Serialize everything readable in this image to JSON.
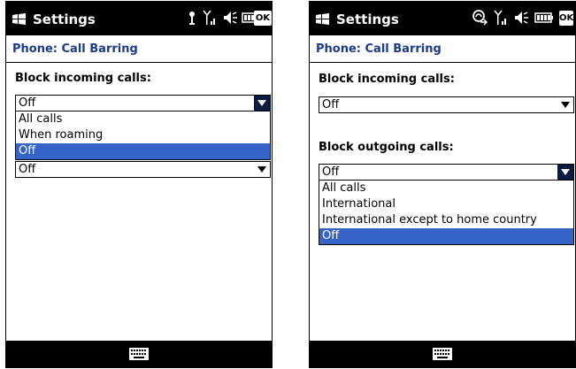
{
  "left": {
    "title": "Settings",
    "ok_label": "OK",
    "header": "Phone: Call Barring",
    "incoming_label": "Block incoming calls:",
    "incoming_value": "Off",
    "incoming_options": [
      "All calls",
      "When roaming",
      "Off"
    ],
    "incoming_selected_index": 2,
    "outgoing_value": "Off",
    "tray_icons": [
      "antenna-icon",
      "signal-icon",
      "speaker-icon",
      "battery-icon"
    ]
  },
  "right": {
    "title": "Settings",
    "ok_label": "OK",
    "header": "Phone: Call Barring",
    "incoming_label": "Block incoming calls:",
    "incoming_value": "Off",
    "outgoing_label": "Block outgoing calls:",
    "outgoing_value": "Off",
    "outgoing_options": [
      "All calls",
      "International",
      "International except to home country",
      "Off"
    ],
    "outgoing_selected_index": 3,
    "tray_icons": [
      "call-forward-icon",
      "signal-icon",
      "speaker-icon",
      "battery-icon"
    ]
  },
  "colors": {
    "titlebar": "#000000",
    "header_text": "#1c3a8a",
    "selection": "#3563c7",
    "combo_arrow_active": "#0b1a40"
  }
}
